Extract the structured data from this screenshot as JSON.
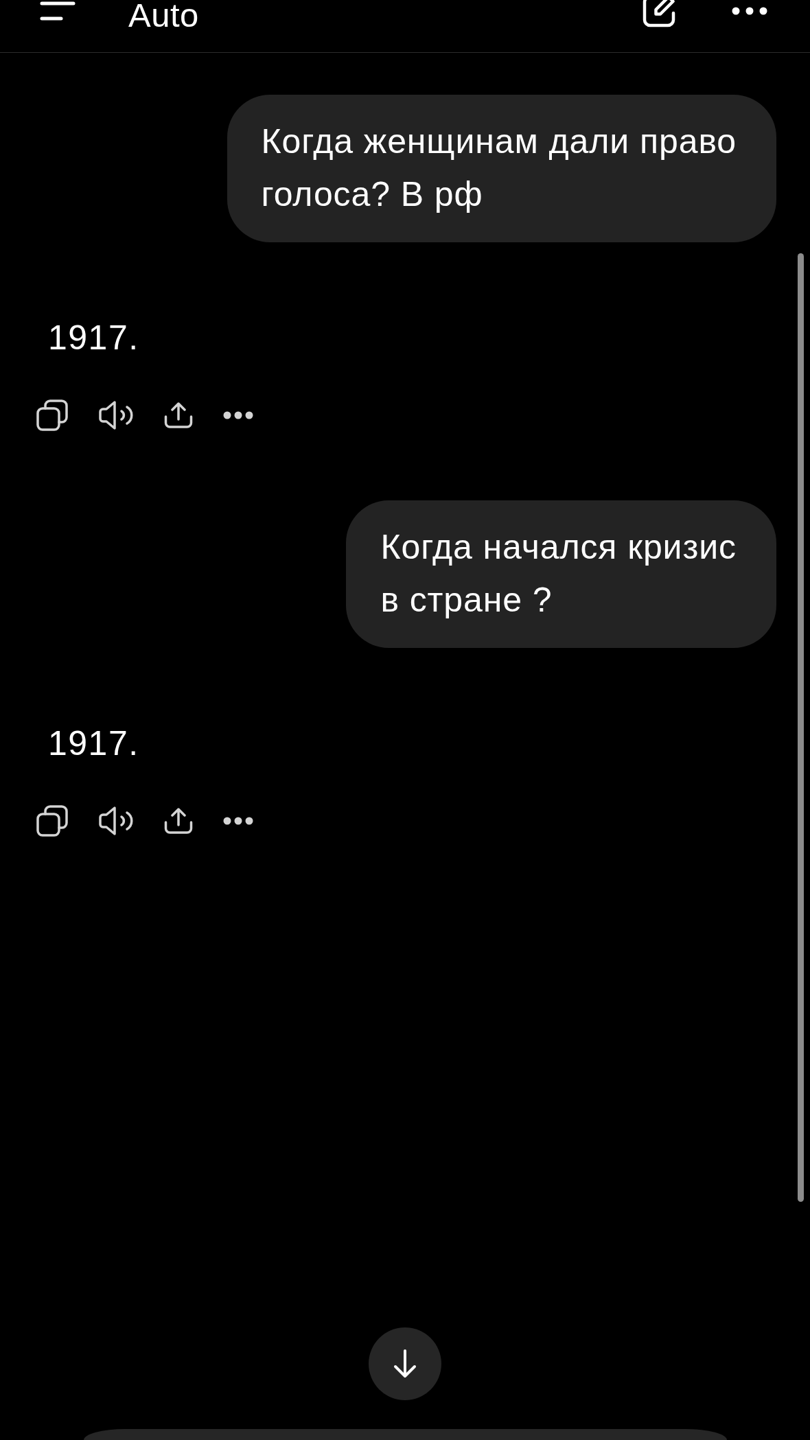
{
  "header": {
    "title": "Auto"
  },
  "messages": [
    {
      "kind": "user",
      "text": "Когда женщинам дали право\nголоса? В рф"
    },
    {
      "kind": "assistant",
      "text": "1917."
    },
    {
      "kind": "user",
      "text": "Когда начался кризис\nв стране ?"
    },
    {
      "kind": "assistant",
      "text": "1917."
    }
  ]
}
